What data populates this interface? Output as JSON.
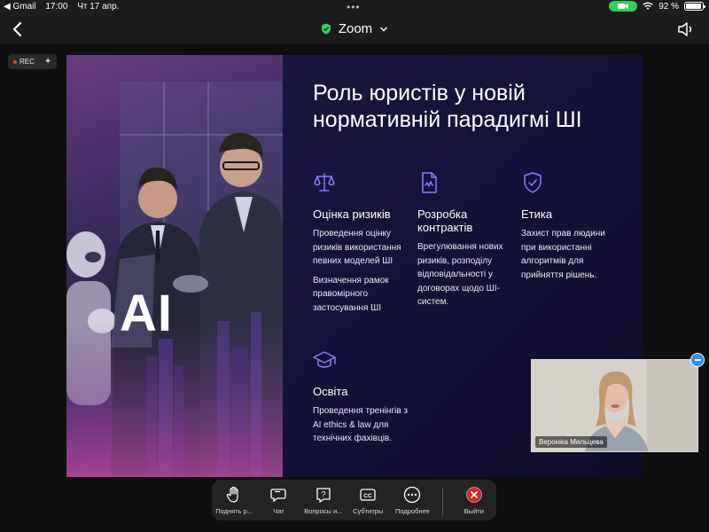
{
  "status_bar": {
    "back_app": "◀ Gmail",
    "time": "17:00",
    "date": "Чт 17 апр.",
    "battery": "92 %",
    "battery_level": 0.92
  },
  "header": {
    "title": "Zoom"
  },
  "recording": {
    "label": "REC"
  },
  "slide": {
    "title": "Роль юристів у новій нормативній парадигмі ШІ",
    "image_text": "AI",
    "blocks": [
      {
        "icon": "scales-icon",
        "heading": "Оцінка ризиків",
        "paragraphs": [
          "Проведення оцінку ризиків використання певних моделей ШІ",
          "Визначення рамок правомірного застосування ШІ"
        ]
      },
      {
        "icon": "document-icon",
        "heading": "Розробка контрактів",
        "paragraphs": [
          "Врегулювання нових ризиків, розподілу відповідальності у договорах щодо ШІ-систем."
        ]
      },
      {
        "icon": "shield-check-icon",
        "heading": "Етика",
        "paragraphs": [
          "Захист прав людини при використанні алгоритмів для прийняття рішень."
        ]
      },
      {
        "icon": "graduation-cap-icon",
        "heading": "Освіта",
        "paragraphs": [
          "Проведення тренінгів з AI ethics & law для технічних фахівців."
        ]
      }
    ]
  },
  "video": {
    "participant_name": "Вероніка Мильцева"
  },
  "toolbar": {
    "items": [
      {
        "icon": "raise-hand-icon",
        "label": "Поднять р..."
      },
      {
        "icon": "chat-icon",
        "label": "Чат"
      },
      {
        "icon": "question-icon",
        "label": "Вопросы и..."
      },
      {
        "icon": "cc-icon",
        "label": "Субтитры"
      },
      {
        "icon": "more-icon",
        "label": "Подробнее"
      }
    ],
    "leave_label": "Выйти"
  },
  "colors": {
    "accent_green": "#30d158",
    "zoom_blue": "#2d8cff",
    "leave_red": "#e02020",
    "slide_bg": "#16133a",
    "icon_violet": "#8b7cff"
  }
}
